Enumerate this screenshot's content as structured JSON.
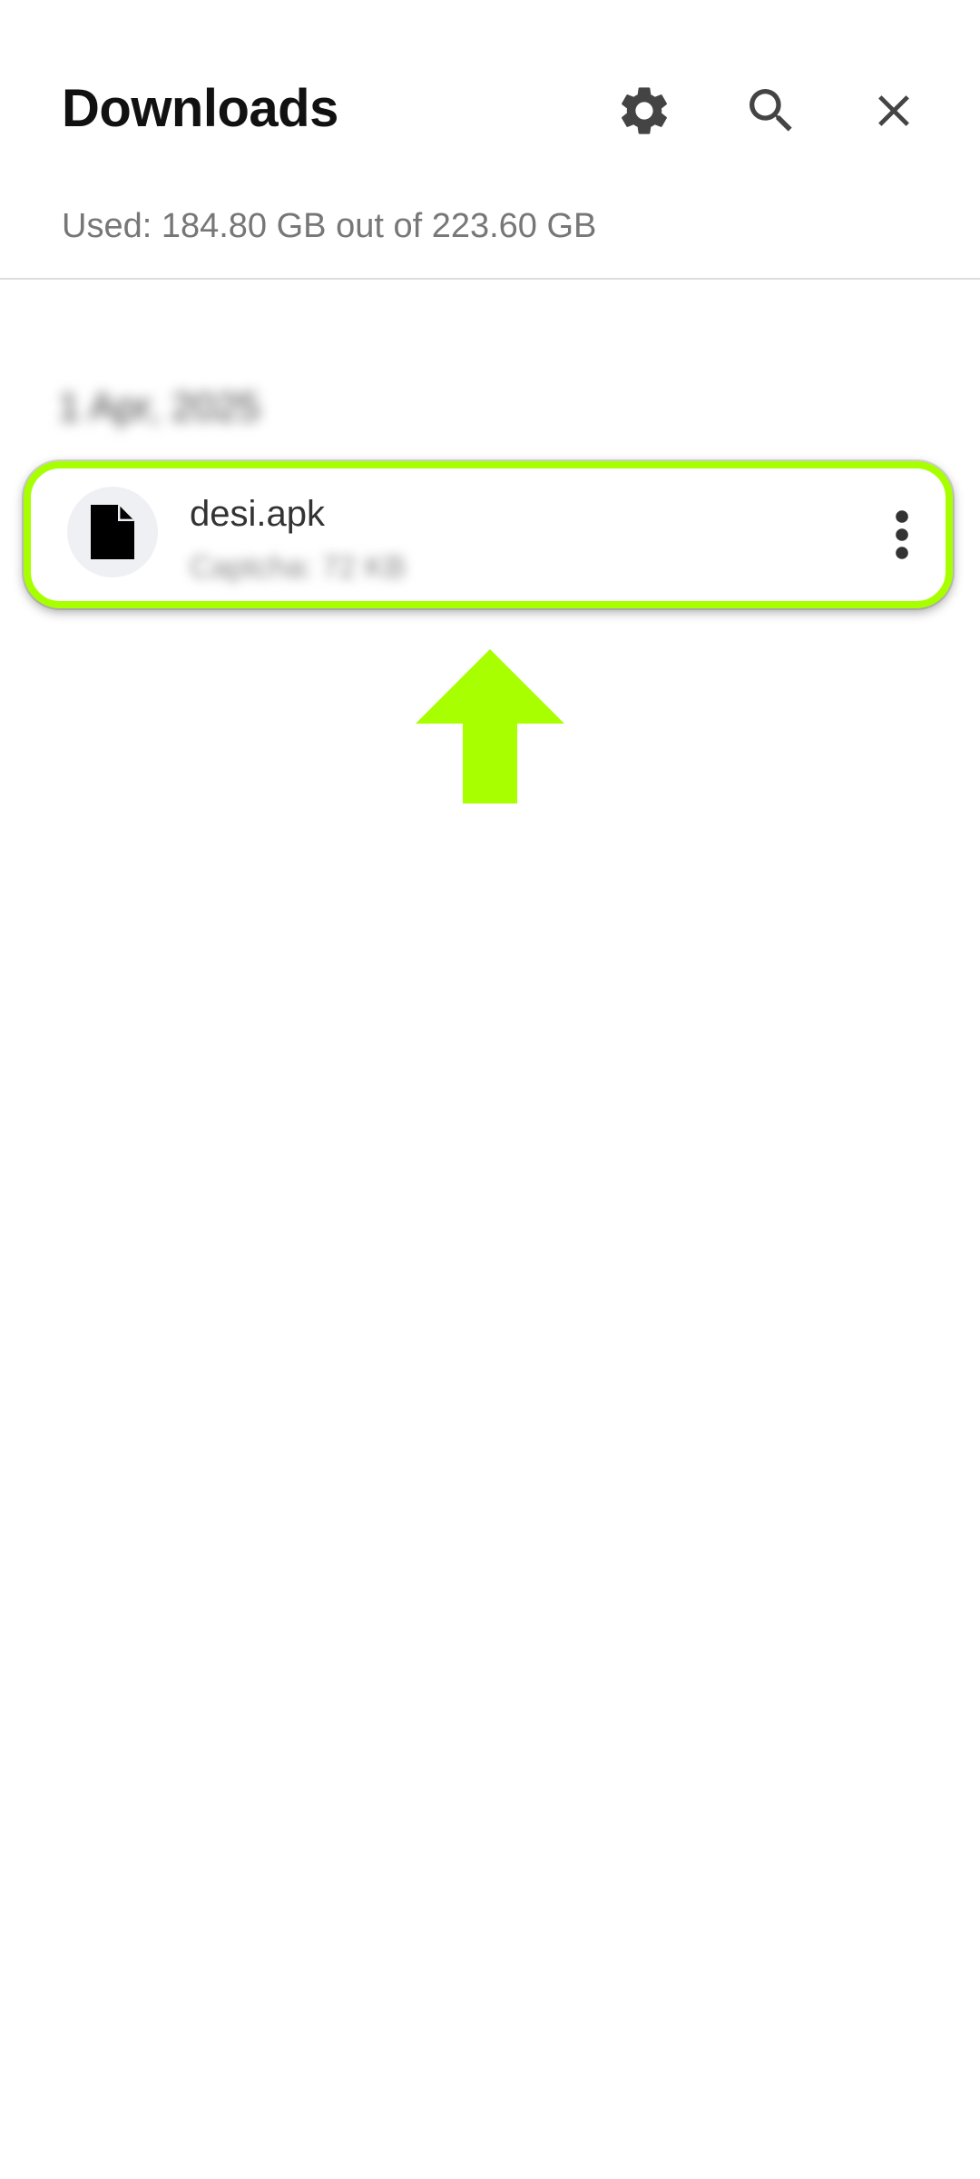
{
  "header": {
    "title": "Downloads",
    "icons": {
      "settings": "gear-icon",
      "search": "search-icon",
      "close": "close-icon"
    }
  },
  "storage": {
    "text": "Used: 184.80 GB out of 223.60 GB"
  },
  "groups": [
    {
      "date": "1 Apr, 2025",
      "items": [
        {
          "name": "desi.apk",
          "meta": "Captcha: 72 KB",
          "icon": "file-icon",
          "menu_icon": "more-vert-icon"
        }
      ]
    }
  ],
  "annotation": {
    "highlight_color": "#a8ff00",
    "arrow_color": "#a8ff00"
  }
}
